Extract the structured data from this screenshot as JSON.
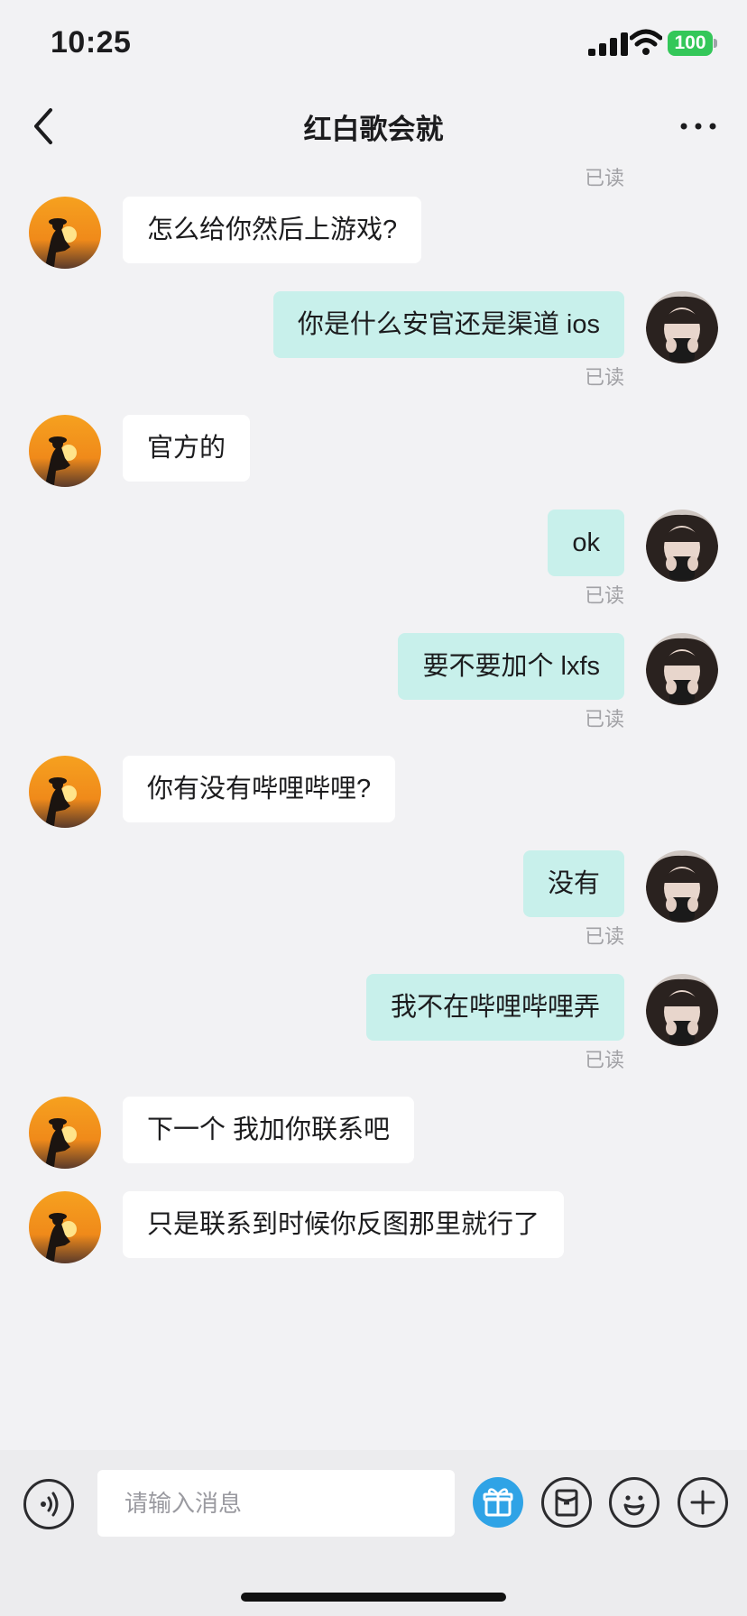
{
  "status_bar": {
    "time": "10:25",
    "battery": "100",
    "battery_color": "#34c759"
  },
  "nav": {
    "title": "红白歌会就",
    "back_icon": "chevron-left-icon",
    "more_icon": "more-dots-icon"
  },
  "chat": {
    "read_label": "已读",
    "incoming_bubble_color": "#ffffff",
    "outgoing_bubble_color": "#c8f0eb",
    "messages": [
      {
        "side": "in",
        "text": "怎么给你然后上游戏?"
      },
      {
        "side": "out",
        "text": "你是什么安官还是渠道 ios"
      },
      {
        "side": "in",
        "text": "官方的"
      },
      {
        "side": "out",
        "text": "ok"
      },
      {
        "side": "out",
        "text": "要不要加个 lxfs"
      },
      {
        "side": "in",
        "text": "你有没有哔哩哔哩?"
      },
      {
        "side": "out",
        "text": "没有"
      },
      {
        "side": "out",
        "text": "我不在哔哩哔哩弄"
      },
      {
        "side": "in",
        "text": "下一个 我加你联系吧"
      },
      {
        "side": "in",
        "text": "只是联系到时候你反图那里就行了"
      }
    ]
  },
  "input_bar": {
    "placeholder": "请输入消息",
    "voice_icon": "voice-icon",
    "gift_icon": "gift-icon",
    "gift_color": "#2fa3e6",
    "redpacket_icon": "red-packet-icon",
    "emoji_icon": "emoji-icon",
    "plus_icon": "plus-icon"
  }
}
